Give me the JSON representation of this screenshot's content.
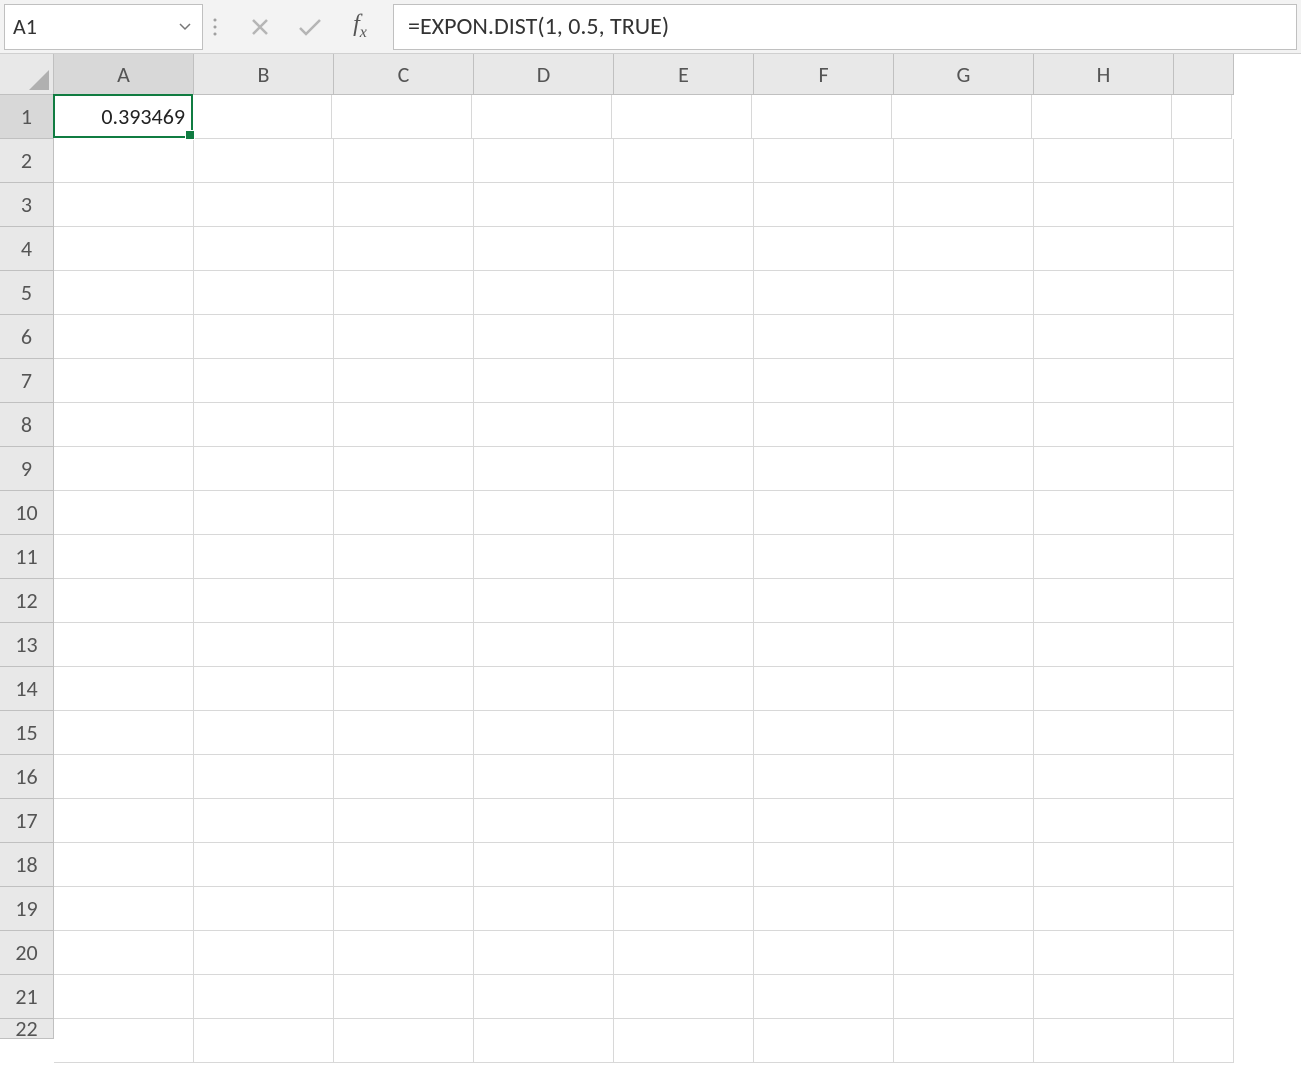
{
  "formula_bar": {
    "name_box_value": "A1",
    "formula_value": "=EXPON.DIST(1, 0.5, TRUE)"
  },
  "columns": [
    "A",
    "B",
    "C",
    "D",
    "E",
    "F",
    "G",
    "H"
  ],
  "rows": [
    "1",
    "2",
    "3",
    "4",
    "5",
    "6",
    "7",
    "8",
    "9",
    "10",
    "11",
    "12",
    "13",
    "14",
    "15",
    "16",
    "17",
    "18",
    "19",
    "20",
    "21",
    "22"
  ],
  "active_cell": {
    "ref": "A1",
    "row": 0,
    "col": 0,
    "display_value": "0.393469"
  },
  "selected_column_index": 0,
  "selected_row_index": 0,
  "colors": {
    "selection_border": "#107c41"
  }
}
